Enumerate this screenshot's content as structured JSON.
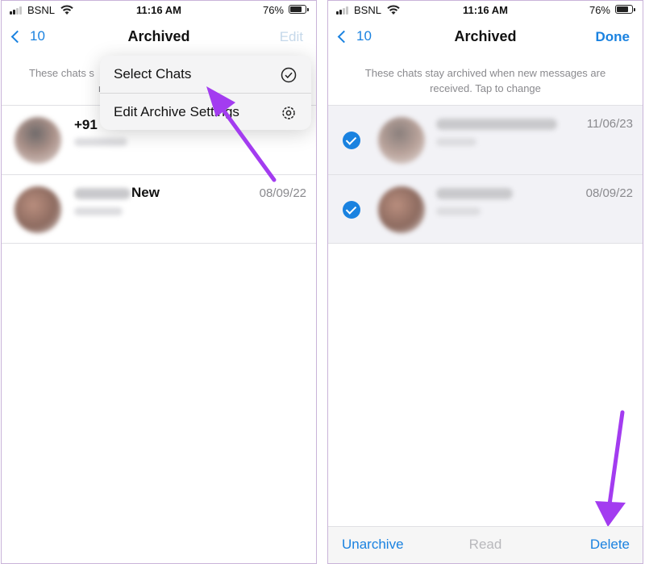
{
  "colors": {
    "accent": "#1a82e0",
    "arrow": "#a33cf0",
    "selected_row_bg": "#f2f2f6",
    "frame_border": "#c9b3d9"
  },
  "left_screen": {
    "status": {
      "carrier": "BSNL",
      "time": "11:16 AM",
      "battery": "76%"
    },
    "nav": {
      "back_count": "10",
      "title": "Archived",
      "right_label": "Edit"
    },
    "archive_note_partial": "These chats s",
    "archive_note_partial2": "re",
    "menu": [
      {
        "label": "Select Chats",
        "icon": "checkmark-circle-icon"
      },
      {
        "label": "Edit Archive Settings",
        "icon": "gear-icon"
      }
    ],
    "chats": [
      {
        "name_partial": "+91",
        "date": ""
      },
      {
        "name_partial": "New",
        "date": "08/09/22"
      }
    ]
  },
  "right_screen": {
    "status": {
      "carrier": "BSNL",
      "time": "11:16 AM",
      "battery": "76%"
    },
    "nav": {
      "back_count": "10",
      "title": "Archived",
      "right_label": "Done"
    },
    "archive_note": "These chats stay archived when new messages are received. Tap to change",
    "chats": [
      {
        "date": "11/06/23",
        "selected": true
      },
      {
        "date": "08/09/22",
        "selected": true
      }
    ],
    "toolbar": {
      "unarchive": "Unarchive",
      "read": "Read",
      "delete": "Delete"
    }
  }
}
